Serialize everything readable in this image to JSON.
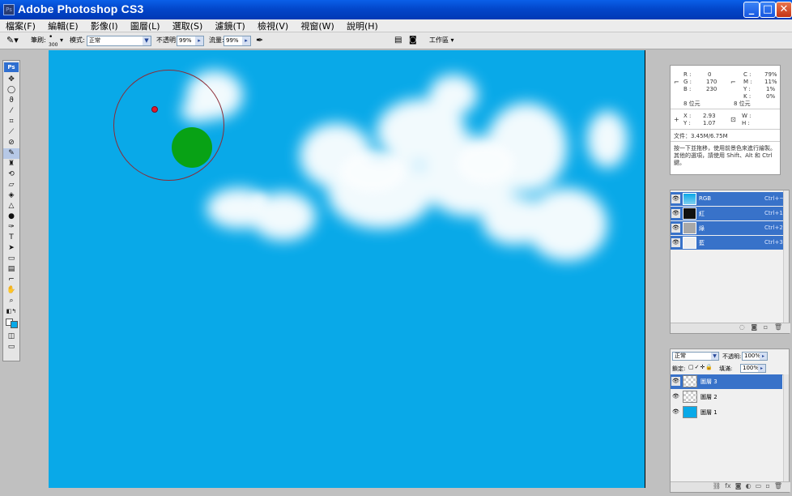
{
  "window": {
    "title": "Adobe Photoshop CS3",
    "icon": "Ps"
  },
  "menu": [
    "檔案(F)",
    "編輯(E)",
    "影像(I)",
    "圖層(L)",
    "選取(S)",
    "濾鏡(T)",
    "檢視(V)",
    "視窗(W)",
    "說明(H)"
  ],
  "options": {
    "brush_label": "筆刷:",
    "brush_size": "300",
    "mode_label": "模式:",
    "mode": "正常",
    "opacity_label": "不透明:",
    "opacity": "99%",
    "flow_label": "流量:",
    "flow": "99%",
    "workspace": "工作區"
  },
  "toolbox": {
    "logo": "Ps"
  },
  "info": {
    "r": "R :",
    "r_val": "0",
    "g": "G :",
    "g_val": "170",
    "b": "B :",
    "b_val": "230",
    "c": "C :",
    "c_val": "79%",
    "m": "M :",
    "m_val": "11%",
    "y": "Y :",
    "y_val": "1%",
    "k": "K :",
    "k_val": "0%",
    "bits1": "8 位元",
    "bits2": "8 位元",
    "x": "X :",
    "x_val": "2.93",
    "yy": "Y :",
    "yy_val": "1.07",
    "w": "W :",
    "h": "H :",
    "doc": "文件：3.45M/6.75M",
    "hint": "按一下並拖移，使用前景色來進行繪製。其他的選項，請使用 Shift、Alt 和 Ctrl 鍵。"
  },
  "channels": [
    {
      "name": "RGB",
      "shortcut": "Ctrl+~"
    },
    {
      "name": "紅",
      "shortcut": "Ctrl+1"
    },
    {
      "name": "綠",
      "shortcut": "Ctrl+2"
    },
    {
      "name": "藍",
      "shortcut": "Ctrl+3"
    }
  ],
  "layers_panel": {
    "blend": "正常",
    "opacity_label": "不透明:",
    "opacity": "100%",
    "lock_label": "鎖定:",
    "fill_label": "填滿:",
    "fill": "100%",
    "layers": [
      {
        "name": "圖層 3"
      },
      {
        "name": "圖層 2"
      },
      {
        "name": "圖層 1"
      }
    ]
  },
  "colors": {
    "sky": "#09a9e8",
    "brush_dot": "#08a215",
    "selected": "#3872c9"
  }
}
